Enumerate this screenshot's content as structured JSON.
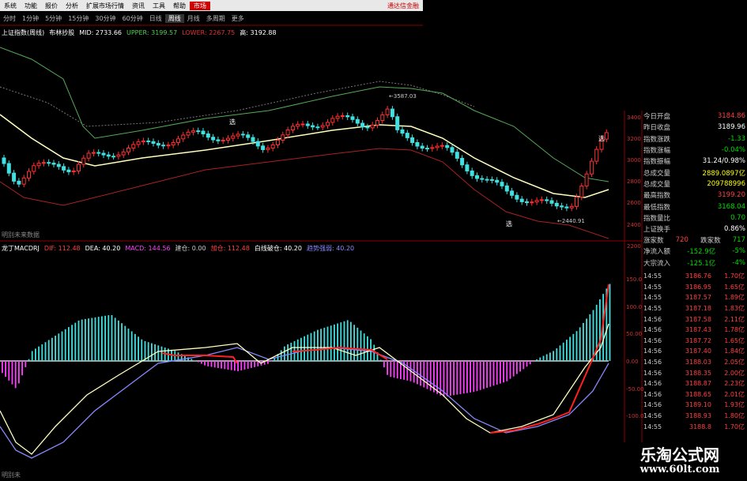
{
  "menu": {
    "items": [
      "系统",
      "功能",
      "报价",
      "分析",
      "扩展市场行情",
      "资讯",
      "工具",
      "帮助"
    ],
    "active": "市场",
    "right_text": "通达信金融"
  },
  "periods": {
    "items": [
      "分时",
      "1分钟",
      "5分钟",
      "15分钟",
      "30分钟",
      "60分钟",
      "日线",
      "周线",
      "月线",
      "多周期",
      "更多"
    ],
    "selected": "周线"
  },
  "kline_header": {
    "title": "上证指数(周线)",
    "indicator": "布林抄股",
    "mid": "MID: 2733.66",
    "upper": "UPPER: 3199.57",
    "lower": "LOWER: 2267.75",
    "high": "高: 3192.88"
  },
  "kline_labels": {
    "peak": "3587.03",
    "trough": "2440.91",
    "mark_top": "选",
    "mark_bottom": "选",
    "mark_right": "选",
    "future": "明别未来数据"
  },
  "price_axis": [
    "3400",
    "3200",
    "3000",
    "2800",
    "2600",
    "2400",
    "2200"
  ],
  "macd_header": {
    "name": "龙丁MACDRJ",
    "dif": "DIF: 112.48",
    "dea": "DEA: 40.20",
    "macd": "MACD: 144.56",
    "buy": "建仓: 0.00",
    "add": "加仓: 112.48",
    "white": "白线破仓: 40.20",
    "blue": "趋势强弱: 40.20"
  },
  "macd_axis": [
    "150.0",
    "100.0",
    "50.00",
    "0.00",
    "-50.00",
    "-100.0"
  ],
  "macd_footer": "明别未",
  "side_stats": [
    {
      "label": "今日开盘",
      "value": "3184.86",
      "color": "#ff4040"
    },
    {
      "label": "昨日收盘",
      "value": "3189.96",
      "color": "#ffffff"
    },
    {
      "label": "指数涨跌",
      "value": "-1.33",
      "color": "#00dd00"
    },
    {
      "label": "指数涨幅",
      "value": "-0.04%",
      "color": "#00dd00"
    },
    {
      "label": "指数振幅",
      "value": "31.24/0.98%",
      "color": "#ffffff"
    },
    {
      "label": "总成交量",
      "value": "2889.0897亿",
      "color": "#ffff00"
    },
    {
      "label": "总成交量",
      "value": "209788996",
      "color": "#ffff00"
    },
    {
      "label": "最高指数",
      "value": "3199.20",
      "color": "#ff4040"
    },
    {
      "label": "最低指数",
      "value": "3168.04",
      "color": "#00dd00"
    },
    {
      "label": "指数量比",
      "value": "0.70",
      "color": "#00dd00"
    },
    {
      "label": "上证换手",
      "value": "0.86%",
      "color": "#ffffff"
    }
  ],
  "updown": {
    "up_label": "涨家数",
    "up": "720",
    "down_label": "跌家数",
    "down": "717"
  },
  "flows": [
    {
      "label": "净流入额",
      "value": "-152.9亿",
      "pct": "-5%"
    },
    {
      "label": "大宗流入",
      "value": "-125.1亿",
      "pct": "-4%"
    }
  ],
  "ticks": [
    {
      "t": "14:55",
      "p": "3186.76",
      "v": "1.70亿"
    },
    {
      "t": "14:55",
      "p": "3186.95",
      "v": "1.65亿"
    },
    {
      "t": "14:55",
      "p": "3187.57",
      "v": "1.89亿"
    },
    {
      "t": "14:55",
      "p": "3187.18",
      "v": "1.83亿"
    },
    {
      "t": "14:56",
      "p": "3187.58",
      "v": "2.11亿"
    },
    {
      "t": "14:56",
      "p": "3187.43",
      "v": "1.78亿"
    },
    {
      "t": "14:56",
      "p": "3187.72",
      "v": "1.65亿"
    },
    {
      "t": "14:56",
      "p": "3187.40",
      "v": "1.84亿"
    },
    {
      "t": "14:56",
      "p": "3188.03",
      "v": "2.05亿"
    },
    {
      "t": "14:56",
      "p": "3188.35",
      "v": "2.00亿"
    },
    {
      "t": "14:56",
      "p": "3188.87",
      "v": "2.23亿"
    },
    {
      "t": "14:56",
      "p": "3188.65",
      "v": "2.01亿"
    },
    {
      "t": "14:56",
      "p": "3189.10",
      "v": "1.93亿"
    },
    {
      "t": "14:56",
      "p": "3188.93",
      "v": "1.80亿"
    },
    {
      "t": "14:55",
      "p": "3188.8",
      "v": "1.70亿"
    }
  ],
  "watermark": {
    "line1": "乐淘公式网",
    "line2": "www.60lt.com"
  },
  "colors": {
    "up": "#ff3030",
    "down": "#40e0e0",
    "mid": "#ffffc0",
    "upper": "#55aa55",
    "lower": "#aa2222",
    "dif": "#ffffc0",
    "dea": "#8888ff",
    "red_line": "#ff2020",
    "magenta": "#ff40ff"
  }
}
